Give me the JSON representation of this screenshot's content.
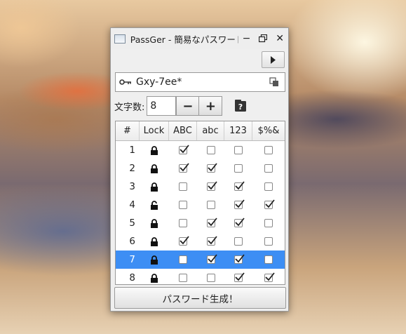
{
  "window": {
    "title": "PassGer - 簡易なパスワード生成",
    "controls": {
      "minimize": "−",
      "maximize": "🗗",
      "close": "✕"
    }
  },
  "password": {
    "value": "Gxy-7ee*",
    "key_icon": "key-icon",
    "copy_icon": "copy-icon"
  },
  "length": {
    "label": "文字数:",
    "value": "8",
    "minus": "−",
    "plus": "+"
  },
  "table": {
    "headers": [
      "#",
      "Lock",
      "ABC",
      "abc",
      "123",
      "$%&"
    ],
    "rows": [
      {
        "n": "1",
        "locked": true,
        "upper": true,
        "lower": false,
        "digit": false,
        "symbol": false,
        "selected": false
      },
      {
        "n": "2",
        "locked": true,
        "upper": true,
        "lower": true,
        "digit": false,
        "symbol": false,
        "selected": false
      },
      {
        "n": "3",
        "locked": true,
        "upper": false,
        "lower": true,
        "digit": true,
        "symbol": false,
        "selected": false
      },
      {
        "n": "4",
        "locked": false,
        "upper": false,
        "lower": false,
        "digit": true,
        "symbol": true,
        "selected": false
      },
      {
        "n": "5",
        "locked": true,
        "upper": false,
        "lower": true,
        "digit": true,
        "symbol": false,
        "selected": false
      },
      {
        "n": "6",
        "locked": true,
        "upper": true,
        "lower": true,
        "digit": false,
        "symbol": false,
        "selected": false
      },
      {
        "n": "7",
        "locked": true,
        "upper": false,
        "lower": true,
        "digit": true,
        "symbol": false,
        "selected": true
      },
      {
        "n": "8",
        "locked": true,
        "upper": false,
        "lower": false,
        "digit": true,
        "symbol": true,
        "selected": false
      }
    ]
  },
  "generate_button": "パスワード生成！",
  "colors": {
    "selection": "#3d8ef4",
    "window_bg": "#efefef"
  }
}
